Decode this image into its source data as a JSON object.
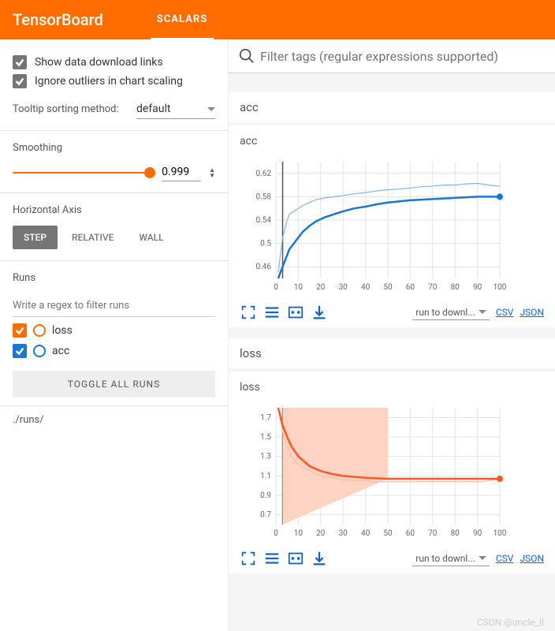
{
  "header": {
    "logo": "TensorBoard",
    "tab": "SCALARS"
  },
  "options": {
    "show_dl": "Show data download links",
    "ignore_out": "Ignore outliers in chart scaling",
    "tooltip_label": "Tooltip sorting method:",
    "tooltip_value": "default"
  },
  "smoothing": {
    "label": "Smoothing",
    "value": "0.999"
  },
  "haxis": {
    "label": "Horizontal Axis",
    "step": "STEP",
    "relative": "RELATIVE",
    "wall": "WALL"
  },
  "runs": {
    "label": "Runs",
    "filter_ph": "Write a regex to filter runs",
    "items": [
      "loss",
      "acc"
    ],
    "toggle": "TOGGLE ALL RUNS",
    "dir": "./runs/"
  },
  "filter": {
    "placeholder": "Filter tags (regular expressions supported)"
  },
  "tools": {
    "dl_select": "run to downl...",
    "csv": "CSV",
    "json": "JSON"
  },
  "watermark": "CSDN @uncle_ll",
  "chart_data": [
    {
      "type": "line",
      "name": "acc",
      "title": "acc",
      "xlabel": "",
      "ylabel": "",
      "xlim": [
        0,
        100
      ],
      "ylim": [
        0.44,
        0.64
      ],
      "xticks": [
        0,
        10,
        20,
        30,
        40,
        50,
        60,
        70,
        80,
        90,
        100
      ],
      "yticks": [
        0.46,
        0.5,
        0.54,
        0.58,
        0.62
      ],
      "series": [
        {
          "name": "acc_raw",
          "color": "#7fb8e6",
          "x": [
            1,
            2,
            3,
            4,
            5,
            6,
            8,
            10,
            12,
            15,
            18,
            22,
            26,
            30,
            35,
            40,
            45,
            50,
            55,
            60,
            65,
            70,
            75,
            80,
            85,
            90,
            95,
            100
          ],
          "y": [
            0.45,
            0.48,
            0.51,
            0.525,
            0.54,
            0.55,
            0.555,
            0.56,
            0.565,
            0.57,
            0.575,
            0.578,
            0.58,
            0.582,
            0.585,
            0.587,
            0.59,
            0.592,
            0.593,
            0.595,
            0.597,
            0.598,
            0.6,
            0.6,
            0.602,
            0.603,
            0.6,
            0.598
          ]
        },
        {
          "name": "acc_smooth",
          "color": "#1976d2",
          "x": [
            1,
            2,
            3,
            4,
            5,
            6,
            8,
            10,
            12,
            15,
            18,
            22,
            26,
            30,
            35,
            40,
            45,
            50,
            55,
            60,
            65,
            70,
            75,
            80,
            85,
            90,
            95,
            100
          ],
          "y": [
            0.44,
            0.45,
            0.46,
            0.47,
            0.48,
            0.49,
            0.5,
            0.51,
            0.52,
            0.53,
            0.538,
            0.545,
            0.55,
            0.555,
            0.56,
            0.563,
            0.567,
            0.57,
            0.572,
            0.574,
            0.575,
            0.576,
            0.577,
            0.578,
            0.579,
            0.58,
            0.58,
            0.58
          ]
        }
      ]
    },
    {
      "type": "line",
      "name": "loss",
      "title": "loss",
      "xlabel": "",
      "ylabel": "",
      "xlim": [
        0,
        100
      ],
      "ylim": [
        0.6,
        1.8
      ],
      "xticks": [
        0,
        10,
        20,
        30,
        40,
        50,
        60,
        70,
        80,
        90,
        100
      ],
      "yticks": [
        0.7,
        0.9,
        1.1,
        1.3,
        1.5,
        1.7
      ],
      "series": [
        {
          "name": "loss_raw",
          "color": "#f9bfa8",
          "x": [
            1,
            3,
            5,
            7,
            10,
            15,
            20,
            25,
            30,
            35,
            40,
            45,
            50,
            55,
            60,
            65,
            70,
            75,
            80,
            85,
            90,
            95,
            100
          ],
          "y": [
            1.8,
            1.55,
            1.4,
            1.3,
            1.22,
            1.15,
            1.1,
            1.08,
            1.06,
            1.05,
            1.05,
            1.04,
            1.04,
            1.04,
            1.04,
            1.04,
            1.04,
            1.04,
            1.04,
            1.04,
            1.04,
            1.05,
            1.07
          ]
        },
        {
          "name": "loss_smooth",
          "color": "#ff5722",
          "x": [
            1,
            3,
            5,
            7,
            10,
            15,
            20,
            25,
            30,
            35,
            40,
            45,
            50,
            55,
            60,
            65,
            70,
            75,
            80,
            85,
            90,
            95,
            100
          ],
          "y": [
            1.8,
            1.62,
            1.5,
            1.4,
            1.3,
            1.2,
            1.15,
            1.12,
            1.1,
            1.09,
            1.08,
            1.075,
            1.07,
            1.07,
            1.07,
            1.07,
            1.07,
            1.07,
            1.07,
            1.07,
            1.07,
            1.07,
            1.07
          ]
        }
      ],
      "shade": {
        "color": "#fdd4c4",
        "x": [
          3,
          50
        ],
        "top": [
          1.8,
          1.8
        ],
        "bottom": [
          0.6,
          1.07
        ]
      }
    }
  ]
}
